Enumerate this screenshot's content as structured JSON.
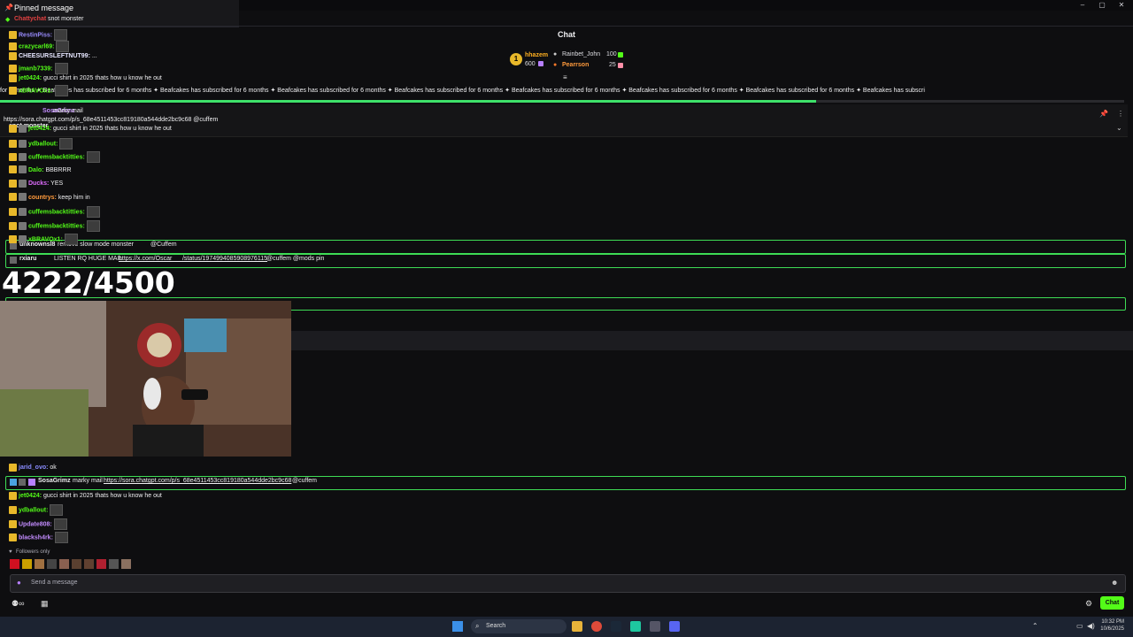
{
  "pinned": {
    "title": "Pinned message",
    "author": "Chattychat",
    "text": "snot monster"
  },
  "window": {
    "minimize": "–",
    "maximize": "▢",
    "close": "✕"
  },
  "chat_title": "Chat",
  "leaderboard": {
    "rank": "1",
    "left": [
      {
        "name": "hhazem",
        "value": "600"
      }
    ],
    "right": [
      {
        "name": "Rainbet_John",
        "value": "100"
      },
      {
        "name": "Pearrson",
        "value": "25"
      }
    ]
  },
  "subbanner": "for 6 months  ✦  Beafcakes has subscribed for 6 months  ✦  Beafcakes has subscribed for 6 months  ✦  Beafcakes has subscribed for 6 months  ✦  Beafcakes has subscribed for 6 months  ✦  Beafcakes has subscribed for 6 months  ✦  Beafcakes has subscribed for 6 months  ✦  Beafcakes has subscribed for 6 months  ✦  Beafcakes has subscri",
  "subprogress": 0.726,
  "top_messages": [
    {
      "name": "RestinPiss",
      "color": "#9a8cff",
      "text": "",
      "emote": true
    },
    {
      "name": "crazycarl69",
      "color": "#53fc18",
      "text": "",
      "emote": true
    },
    {
      "name": "CHEESURSLEFTNUT99",
      "color": "#e6e6ff",
      "text": "...",
      "emote": false
    },
    {
      "name": "jmanb7339",
      "color": "#53fc18",
      "text": "",
      "emote": true
    },
    {
      "name": "jet0424",
      "color": "#53fc18",
      "text": "gucci shirt in 2025 thats how u know he out",
      "emote": false
    },
    {
      "name": "xBRAVOx1",
      "color": "#53fc18",
      "text": "",
      "emote": true
    }
  ],
  "overlay_pin": {
    "name": "SosaGrimz",
    "text": "marky mail",
    "url": "https://sora.chatgpt.com/p/s_68e4511453cc819180a544dde2bc9c68 @cuffem",
    "subtitle": "snot monster"
  },
  "mid_messages": [
    {
      "name": "jet0424",
      "color": "#53fc18",
      "text": "gucci shirt in 2025 thats how u know he out"
    },
    {
      "name": "ydballout",
      "color": "#53fc18",
      "text": ""
    },
    {
      "name": "cuffemsbacktitties",
      "color": "#53fc18",
      "text": ""
    },
    {
      "name": "Dalo",
      "color": "#53fc18",
      "text": "BBBRRR"
    },
    {
      "name": "Ducks",
      "color": "#e06dff",
      "text": "YES"
    },
    {
      "name": "countrys",
      "color": "#ff9a3c",
      "text": "keep him in"
    },
    {
      "name": "cuffemsbacktitties",
      "color": "#53fc18",
      "text": ""
    },
    {
      "name": "cuffemsbacktitties",
      "color": "#53fc18",
      "text": ""
    },
    {
      "name": "xBRAVOx1",
      "color": "#53fc18",
      "text": ""
    }
  ],
  "highlight1": {
    "name": "unknownsl8",
    "color": "#ff6b4d",
    "text": "remove slow mode monster",
    "mention": "@Cuffem"
  },
  "highlight2": {
    "name": "rxiaru",
    "color": "#ff3030",
    "text": "LISTEN RQ HUGE MAIL",
    "url": "https://x.com/Oscar___/status/1974994085908976115",
    "tail": "@cuffem @mods pin"
  },
  "counter": "4222/4500",
  "bottom_messages": [
    {
      "name": "jarid_ovo",
      "color": "#8a8cff",
      "text": "ok"
    },
    {
      "name": "jet0424",
      "color": "#53fc18",
      "text": "gucci shirt in 2025 thats how u know he out"
    },
    {
      "name": "ydballout",
      "color": "#53fc18",
      "text": ""
    },
    {
      "name": "Update808",
      "color": "#c38cff",
      "text": ""
    },
    {
      "name": "blacksh4rk",
      "color": "#c38cff",
      "text": ""
    }
  ],
  "highlight3": {
    "name": "SosaGrimz",
    "color": "#c38cff",
    "text": "marky mail",
    "url": "https://sora.chatgpt.com/p/s_68e4511453cc819180a544dde2bc9c68",
    "tail": "@cuffem"
  },
  "followers_only": "Followers only",
  "input_placeholder": "Send a message",
  "send_label": "Chat",
  "taskbar": {
    "search": "Search",
    "time": "10:32 PM",
    "date": "10/6/2025"
  },
  "colors": {
    "accent": "#53fc18",
    "highlight_border": "#3edc55",
    "bg": "#0e0e10"
  }
}
